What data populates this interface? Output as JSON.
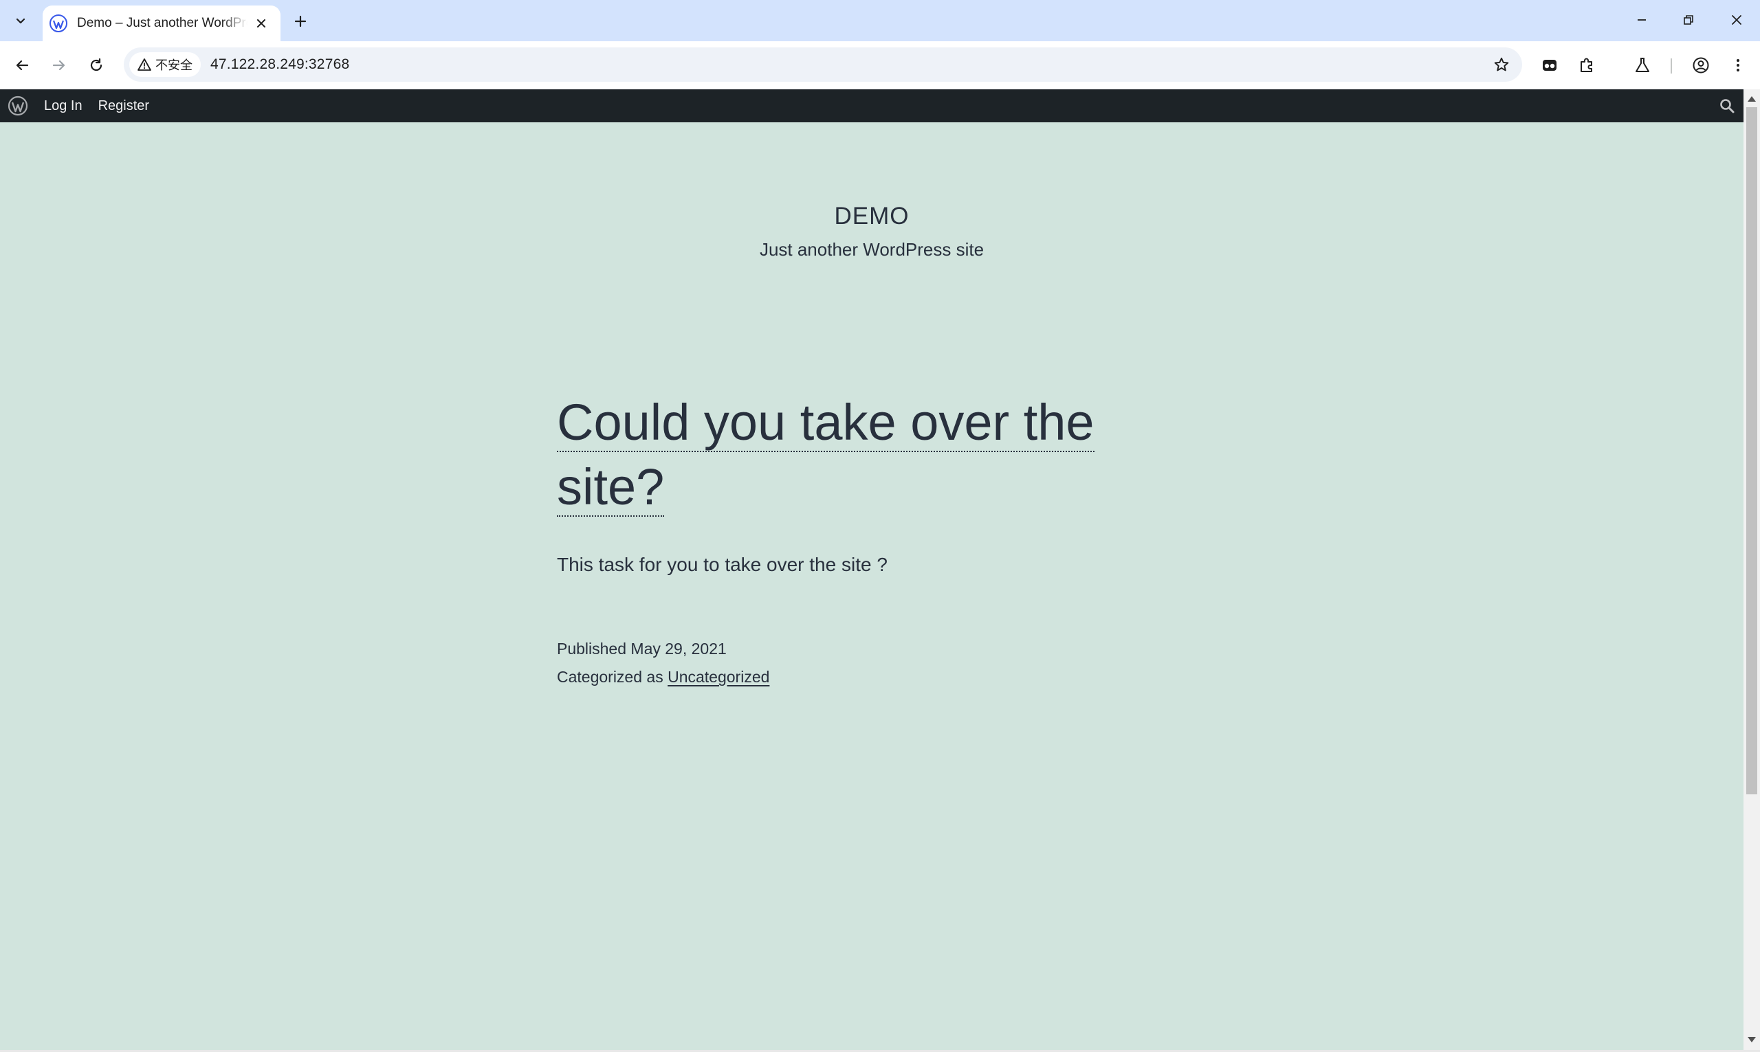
{
  "browser": {
    "tab": {
      "title": "Demo – Just another WordPress site"
    },
    "toolbar": {
      "security_label": "不安全",
      "url": "47.122.28.249:32768"
    }
  },
  "admin_bar": {
    "login_label": "Log In",
    "register_label": "Register"
  },
  "site": {
    "title": "DEMO",
    "description": "Just another WordPress site"
  },
  "post": {
    "title_line1": "Could you take over the",
    "title_line2": "site?",
    "body": "This task for you to take over the site ?",
    "published": "Published May 29, 2021",
    "categorized_prefix": "Categorized as ",
    "category": "Uncategorized"
  },
  "colors": {
    "page_background": "#d1e4dd",
    "admin_bar": "#1d2327",
    "text": "#28303d",
    "tabstrip": "#d3e3fd"
  }
}
